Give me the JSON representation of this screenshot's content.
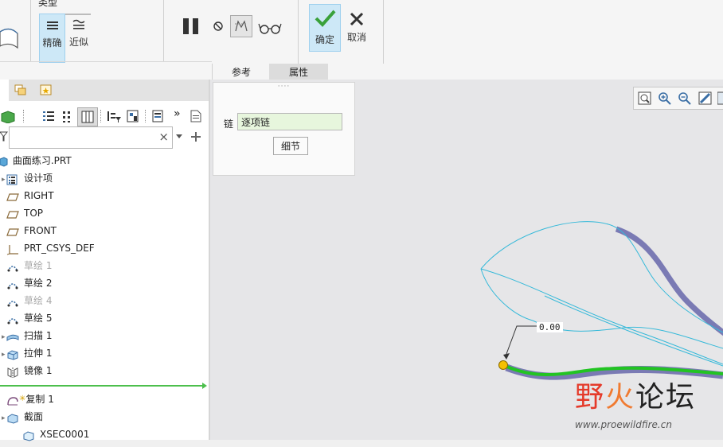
{
  "ribbon": {
    "group_label_partial": "类型",
    "precise_label": "精确",
    "approx_label": "近似",
    "ok_label": "确定",
    "cancel_label": "取消"
  },
  "tabs": {
    "reference": "参考",
    "properties": "属性"
  },
  "search": {
    "value": "",
    "clear_glyph": "×"
  },
  "tree": {
    "root": "曲面练习.PRT",
    "items": [
      {
        "label": "设计项",
        "icon": "design-items-icon",
        "dim": false
      },
      {
        "label": "RIGHT",
        "icon": "datum-plane-icon",
        "dim": false
      },
      {
        "label": "TOP",
        "icon": "datum-plane-icon",
        "dim": false
      },
      {
        "label": "FRONT",
        "icon": "datum-plane-icon",
        "dim": false
      },
      {
        "label": "PRT_CSYS_DEF",
        "icon": "csys-icon",
        "dim": false
      },
      {
        "label": "草绘 1",
        "icon": "sketch-icon",
        "dim": true
      },
      {
        "label": "草绘 2",
        "icon": "sketch-icon",
        "dim": false
      },
      {
        "label": "草绘 4",
        "icon": "sketch-icon",
        "dim": true
      },
      {
        "label": "草绘 5",
        "icon": "sketch-icon",
        "dim": false
      },
      {
        "label": "扫描 1",
        "icon": "sweep-icon",
        "dim": false
      },
      {
        "label": "拉伸 1",
        "icon": "extrude-icon",
        "dim": false
      },
      {
        "label": "镜像 1",
        "icon": "mirror-icon",
        "dim": false
      }
    ],
    "after_insert": [
      {
        "label": "复制 1",
        "icon": "copy-icon"
      },
      {
        "label": "截面",
        "icon": "section-icon"
      },
      {
        "label": "XSEC0001",
        "icon": "xsec-icon"
      }
    ]
  },
  "refpanel": {
    "dots": "····",
    "chain_label": "链",
    "chain_value": "逐项链",
    "details_button": "细节"
  },
  "canvas": {
    "dimension_value": "0.00"
  },
  "watermark": {
    "brand": "野火论坛",
    "url": "www.proewildfire.cn"
  },
  "colors": {
    "selected_bg": "#cde8f7",
    "ok_check": "#3aa13a",
    "curve_cyan": "#35b9d9",
    "surface_purple": "#7a7ab4",
    "chain_green": "#22c422",
    "point_yellow": "#f5c000",
    "watermark_red": "#e53a2a"
  }
}
